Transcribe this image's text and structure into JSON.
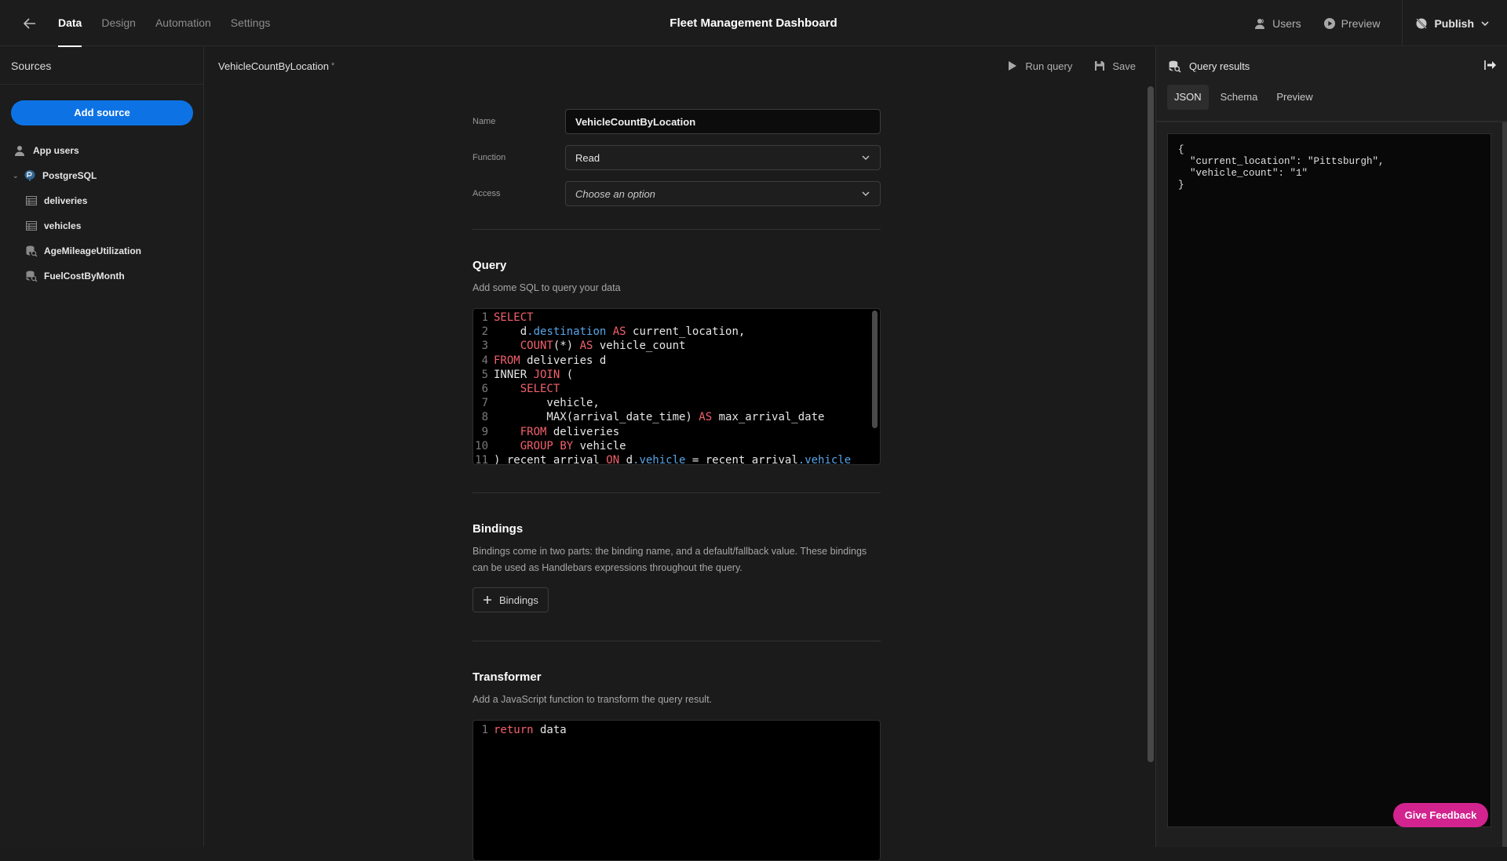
{
  "topbar": {
    "back_icon": "arrow-left-icon",
    "tabs": [
      {
        "label": "Data",
        "active": true
      },
      {
        "label": "Design",
        "active": false
      },
      {
        "label": "Automation",
        "active": false
      },
      {
        "label": "Settings",
        "active": false
      }
    ],
    "title": "Fleet Management Dashboard",
    "users_label": "Users",
    "preview_label": "Preview",
    "publish_label": "Publish"
  },
  "sidebar": {
    "title": "Sources",
    "add_source_label": "Add source",
    "items": [
      {
        "label": "App users",
        "icon": "users-icon",
        "level": 0
      },
      {
        "label": "PostgreSQL",
        "icon": "postgresql-icon",
        "level": 0,
        "expanded": true
      },
      {
        "label": "deliveries",
        "icon": "table-icon",
        "level": 1
      },
      {
        "label": "vehicles",
        "icon": "table-icon",
        "level": 1
      },
      {
        "label": "AgeMileageUtilization",
        "icon": "query-icon",
        "level": 1
      },
      {
        "label": "FuelCostByMonth",
        "icon": "query-icon",
        "level": 1
      }
    ]
  },
  "editor": {
    "query_name": "VehicleCountByLocation",
    "unsaved_marker": "*",
    "run_query_label": "Run query",
    "save_label": "Save",
    "form": {
      "name_label": "Name",
      "name_value": "VehicleCountByLocation",
      "function_label": "Function",
      "function_value": "Read",
      "access_label": "Access",
      "access_placeholder": "Choose an option"
    },
    "query_section": {
      "title": "Query",
      "description": "Add some SQL to query your data",
      "lines": [
        "SELECT",
        "    d.destination AS current_location,",
        "    COUNT(*) AS vehicle_count",
        "FROM deliveries d",
        "INNER JOIN (",
        "    SELECT",
        "        vehicle,",
        "        MAX(arrival_date_time) AS max_arrival_date",
        "    FROM deliveries",
        "    GROUP BY vehicle",
        ") recent_arrival ON d.vehicle = recent_arrival.vehicle"
      ]
    },
    "bindings_section": {
      "title": "Bindings",
      "description": "Bindings come in two parts: the binding name, and a default/fallback value. These bindings can be used as Handlebars expressions throughout the query.",
      "button_label": "Bindings"
    },
    "transformer_section": {
      "title": "Transformer",
      "description": "Add a JavaScript function to transform the query result.",
      "lines": [
        "return data"
      ]
    }
  },
  "results": {
    "title": "Query results",
    "tabs": [
      {
        "label": "JSON",
        "active": true
      },
      {
        "label": "Schema",
        "active": false
      },
      {
        "label": "Preview",
        "active": false
      }
    ],
    "json_text": "{\n  \"current_location\": \"Pittsburgh\",\n  \"vehicle_count\": \"1\"\n}"
  },
  "feedback_label": "Give Feedback",
  "colors": {
    "primary": "#0d73e5",
    "feedback": "#d2238f",
    "keyword": "#f2616d",
    "property": "#59a6e8"
  }
}
